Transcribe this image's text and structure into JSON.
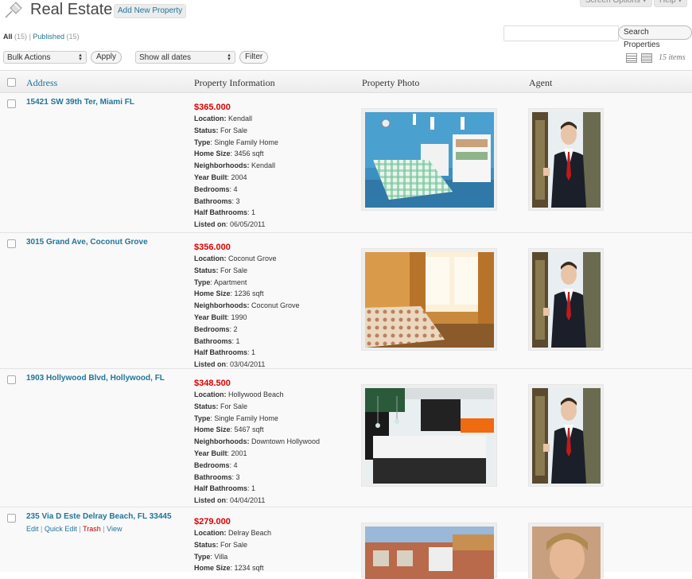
{
  "header": {
    "title": "Real Estate",
    "add_new": "Add New Property",
    "screen_options": "Screen Options ▾",
    "help": "Help ▾"
  },
  "filters": {
    "all_label": "All",
    "all_count": "(15)",
    "separator": "|",
    "published_label": "Published",
    "published_count": "(15)"
  },
  "search": {
    "placeholder": "",
    "button": "Search Properties"
  },
  "toolbar": {
    "bulk_actions": "Bulk Actions",
    "apply": "Apply",
    "dates": "Show all dates",
    "filter": "Filter",
    "items_count": "15 items"
  },
  "columns": {
    "address": "Address",
    "info": "Property Information",
    "photo": "Property Photo",
    "agent": "Agent"
  },
  "labels": {
    "location": "Location:",
    "status": "Status:",
    "type": "Type",
    "home_size": "Home Size",
    "neighborhoods": "Neighborhoods:",
    "year_built": "Year Built",
    "bedrooms": "Bedrooms",
    "bathrooms": "Bathrooms",
    "half_bathrooms": "Half Bathrooms",
    "listed_on": "Listed on"
  },
  "row_actions": {
    "edit": "Edit",
    "quick_edit": "Quick Edit",
    "trash": "Trash",
    "view": "View",
    "sep": "|"
  },
  "properties": [
    {
      "address": "15421 SW 39th Ter, Miami FL",
      "price": "$365.000",
      "location": "Kendall",
      "status": "For Sale",
      "type": "Single Family Home",
      "home_size": "3456 sqft",
      "neighborhoods": "Kendall",
      "year_built": "2004",
      "bedrooms": "4",
      "bathrooms": "3",
      "half_bathrooms": "1",
      "listed_on": "06/05/2011",
      "photo_icon": "bedroom-blue-photo",
      "agent_icon": "agent-suit-photo"
    },
    {
      "address": "3015 Grand Ave, Coconut Grove",
      "price": "$356.000",
      "location": "Coconut Grove",
      "status": "For Sale",
      "type": "Apartment",
      "home_size": "1236 sqft",
      "neighborhoods": "Coconut Grove",
      "year_built": "1990",
      "bedrooms": "2",
      "bathrooms": "1",
      "half_bathrooms": "1",
      "listed_on": "03/04/2011",
      "photo_icon": "bedroom-warm-photo",
      "agent_icon": "agent-suit-photo"
    },
    {
      "address": "1903 Hollywood Blvd, Hollywood, FL",
      "price": "$348.500",
      "location": "Hollywood Beach",
      "status": "For Sale",
      "type": "Single Family Home",
      "home_size": "5467 sqft",
      "neighborhoods": "Downtown Hollywood",
      "year_built": "2001",
      "bedrooms": "4",
      "bathrooms": "3",
      "half_bathrooms": "1",
      "listed_on": "04/04/2011",
      "photo_icon": "kitchen-photo",
      "agent_icon": "agent-suit-photo"
    },
    {
      "address": "235 Via D Este Delray Beach, FL 33445",
      "price": "$279.000",
      "location": "Delray Beach",
      "status": "For Sale",
      "type": "Villa",
      "home_size": "1234 sqft",
      "photo_icon": "villa-exterior-photo",
      "agent_icon": "agent-portrait-photo"
    }
  ],
  "colors": {
    "link": "#21759b",
    "price": "#dd0000",
    "trash": "#bb0000"
  }
}
